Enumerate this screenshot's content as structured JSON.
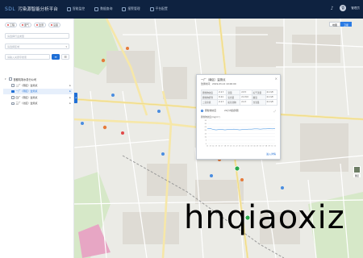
{
  "app": {
    "logo_mark": "SDL",
    "title": "污染源智能分析平台"
  },
  "nav": [
    {
      "label": "智能监控",
      "icon": "monitor-icon"
    },
    {
      "label": "数据查询",
      "icon": "table-icon"
    },
    {
      "label": "报警管理",
      "icon": "alarm-icon"
    },
    {
      "label": "平台配置",
      "icon": "gear-icon"
    }
  ],
  "user": {
    "avatar": "管",
    "name": "管理员"
  },
  "left": {
    "tags": [
      "工程",
      "废气",
      "监测",
      "设备"
    ],
    "industry_placeholder": "请选择行业类型",
    "region_placeholder": "请选择区域",
    "search_placeholder": "请输入关键字搜索",
    "search_button": "≡",
    "filter_button": "☰",
    "tree_root": "首都机场水务分公司",
    "tree_items": [
      {
        "label": "二厂（南区）监测点",
        "active": false
      },
      {
        "label": "一厂（南区）监测点",
        "active": true
      },
      {
        "label": "四厂（南区）监测点",
        "active": false
      },
      {
        "label": "三厂（北区）监测点",
        "active": false
      }
    ]
  },
  "map": {
    "toggle_map": "地图",
    "toggle_sat": "卫星",
    "layer_label": "图层"
  },
  "popup": {
    "title": "一厂（南区）监测点",
    "time": "监测时间：2019-03-12 10:00:00",
    "rows": [
      [
        "颗粒物浓度",
        "2.1 t",
        "流量",
        "2.3 t",
        "标干流量",
        "2.1 t/h"
      ],
      [
        "颗粒物折算",
        "0.11",
        "氧含量",
        "2.1 t/d",
        "烟温",
        "2.1 t/h"
      ],
      [
        "二氧化硫",
        "2.1 t",
        "氮氧化物",
        "2.1 t",
        "含湿量",
        "2.1 t/h"
      ]
    ],
    "tab_a": "颗粒物浓度",
    "tab_b": "24小时趋势图",
    "chart_label": "颗粒物浓度(mg/m³)",
    "link": "进入详情"
  },
  "chart_data": {
    "type": "line",
    "x": [
      "12",
      "13",
      "14",
      "15",
      "16",
      "17",
      "18",
      "19",
      "20",
      "21",
      "22",
      "23",
      "00",
      "01",
      "02",
      "03",
      "04",
      "05",
      "06",
      "07",
      "08",
      "09",
      "10",
      "11"
    ],
    "y_ticks": [
      "35",
      "30",
      "25",
      "20",
      "15",
      "10",
      "5",
      "0"
    ],
    "ylim": [
      0,
      35
    ],
    "series": [
      {
        "values": [
          22,
          22.5,
          21,
          20.5,
          21,
          21,
          20.5,
          21,
          21,
          21.5,
          21,
          20.5,
          21,
          21,
          21.5,
          21.5,
          22,
          22,
          21.5,
          22,
          22,
          22.5,
          22,
          22.5
        ]
      }
    ],
    "grid": true,
    "line_color": "#5aa0e6"
  },
  "watermark": "hnqiaoxiz"
}
